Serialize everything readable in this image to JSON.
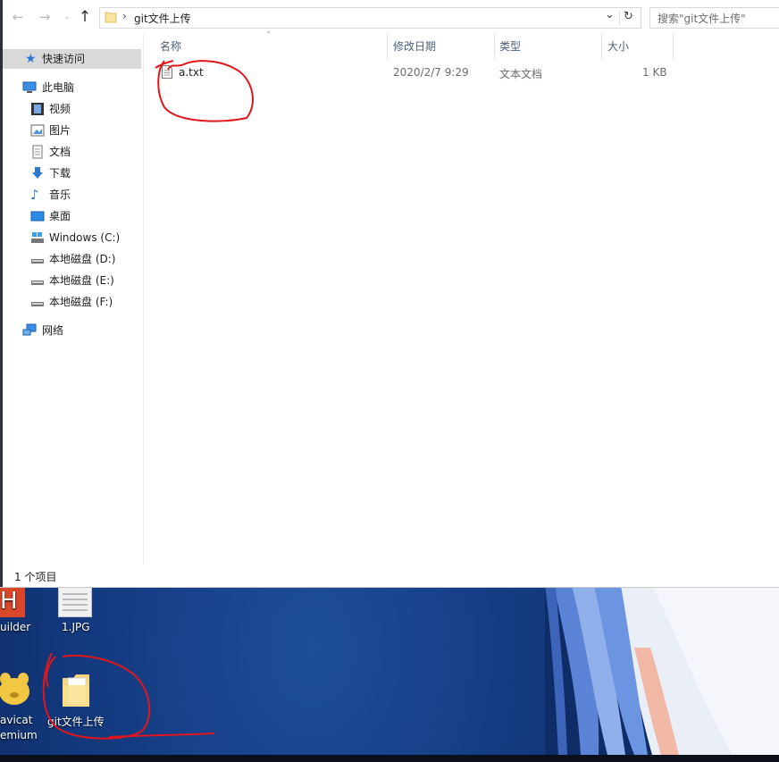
{
  "window": {
    "title": "git文件上传",
    "address": {
      "path_segments": [
        "git文件上传"
      ],
      "refresh_icon": "refresh-icon",
      "dropdown_icon": "chevron-down-icon"
    },
    "search": {
      "placeholder": "搜索\"git文件上传\""
    },
    "nav": {
      "back_icon": "arrow-left-icon",
      "forward_icon": "arrow-right-icon",
      "recent_icon": "chevron-down-icon",
      "up_icon": "arrow-up-icon"
    }
  },
  "sidebar": {
    "quick_access": {
      "label": "快速访问",
      "icon": "star-icon"
    },
    "this_pc": {
      "label": "此电脑",
      "icon": "computer-icon"
    },
    "items": [
      {
        "label": "视频",
        "icon": "video-folder-icon"
      },
      {
        "label": "图片",
        "icon": "pictures-folder-icon"
      },
      {
        "label": "文档",
        "icon": "documents-folder-icon"
      },
      {
        "label": "下载",
        "icon": "download-arrow-icon"
      },
      {
        "label": "音乐",
        "icon": "music-note-icon"
      },
      {
        "label": "桌面",
        "icon": "desktop-folder-icon"
      },
      {
        "label": "Windows (C:)",
        "icon": "system-drive-icon"
      },
      {
        "label": "本地磁盘 (D:)",
        "icon": "drive-icon"
      },
      {
        "label": "本地磁盘 (E:)",
        "icon": "drive-icon"
      },
      {
        "label": "本地磁盘 (F:)",
        "icon": "drive-icon"
      }
    ],
    "network": {
      "label": "网络",
      "icon": "network-icon"
    }
  },
  "file_list": {
    "columns": [
      "名称",
      "修改日期",
      "类型",
      "大小"
    ],
    "sort_icon": "sort-ascending-icon",
    "rows": [
      {
        "name": "a.txt",
        "modified": "2020/2/7 9:29",
        "type": "文本文档",
        "size": "1 KB",
        "icon": "text-file-icon"
      }
    ]
  },
  "statusbar": {
    "item_count": "1 个项目"
  },
  "desktop": {
    "icons": [
      {
        "label": "uilder",
        "icon": "hbuilder-icon"
      },
      {
        "label": "1.JPG",
        "icon": "image-file-icon"
      },
      {
        "label": "avicat",
        "label2": "emium",
        "icon": "navicat-icon"
      },
      {
        "label": "git文件上传",
        "icon": "folder-icon"
      }
    ]
  },
  "colors": {
    "annotation_red": "#e0161b",
    "selection_gray": "#d9d9d9",
    "folder_yellow": "#f5d57a",
    "desktop_blue": "#12367a"
  }
}
